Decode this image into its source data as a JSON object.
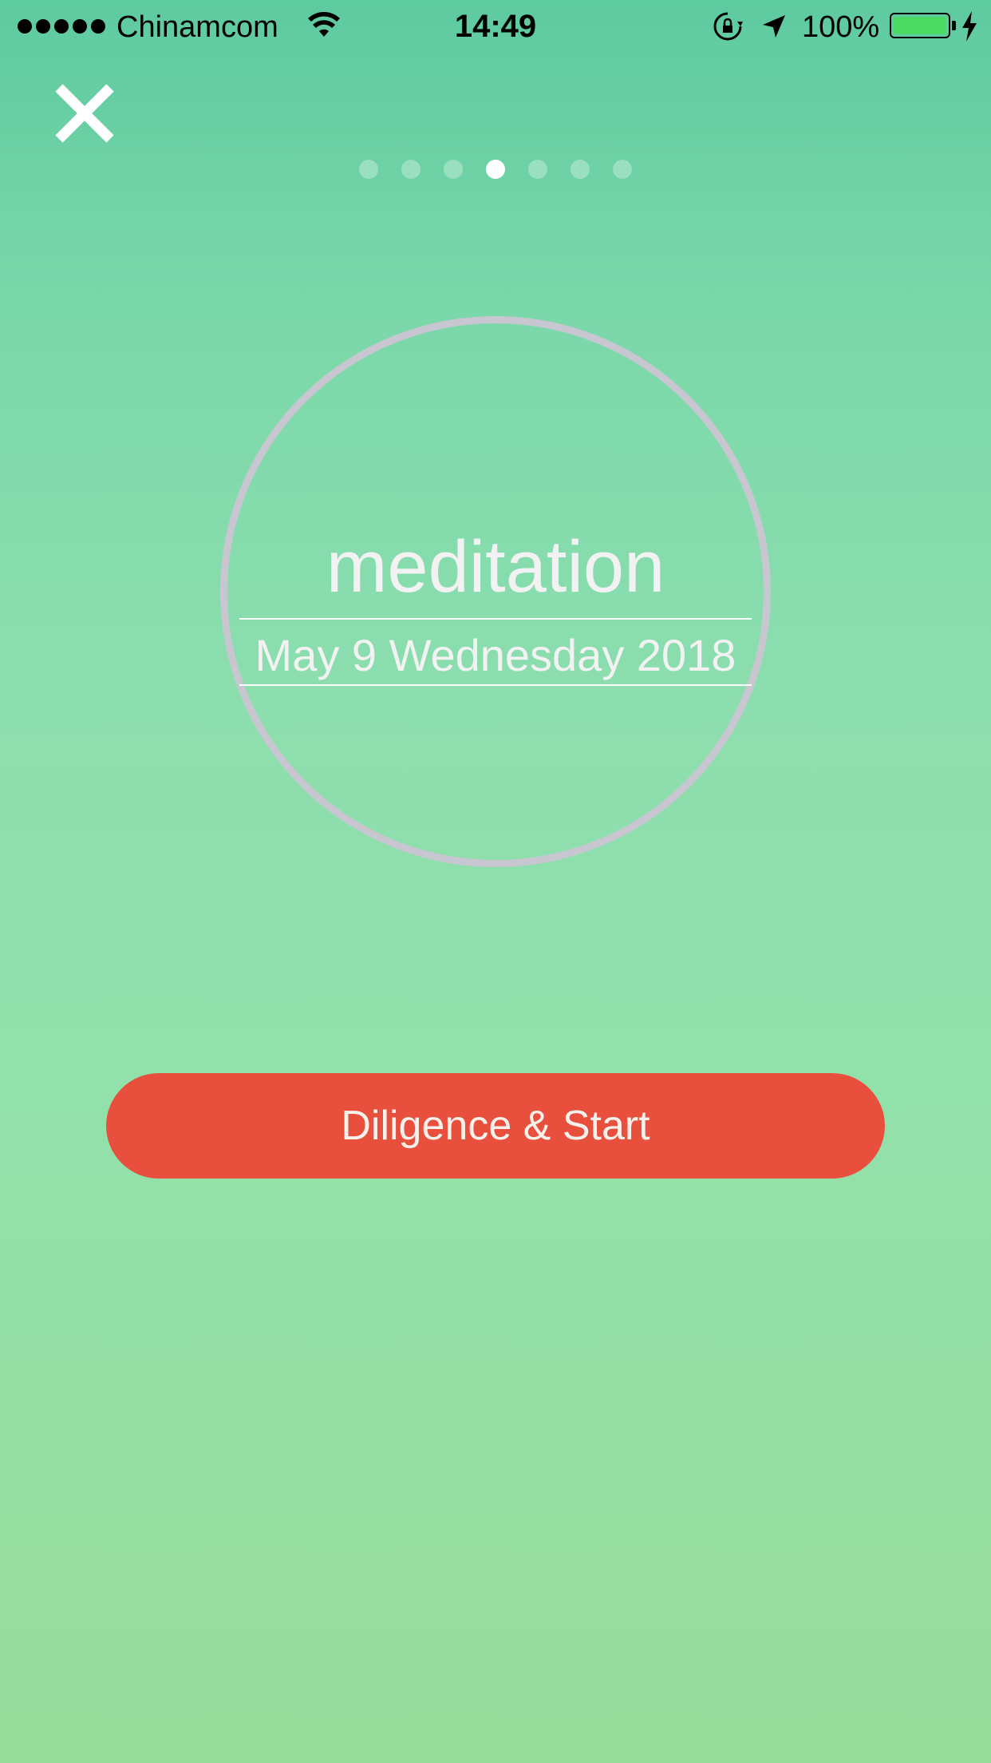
{
  "status_bar": {
    "carrier": "Chinamcom",
    "time": "14:49",
    "battery_percent": "100%",
    "battery_level": 1.0,
    "signal_bars": 5
  },
  "icons": {
    "close": "close-icon",
    "wifi": "wifi-icon",
    "rotation_lock": "rotation-lock-icon",
    "location": "location-arrow-icon",
    "battery": "battery-icon",
    "charging": "charging-bolt-icon"
  },
  "pager": {
    "count": 7,
    "active_index": 3
  },
  "activity": {
    "title": "meditation",
    "date": "May 9 Wednesday 2018"
  },
  "actions": {
    "start_label": "Diligence & Start"
  },
  "colors": {
    "background_top": "#5ecaa0",
    "background_bottom": "#97dc9a",
    "accent_button": "#e8503d",
    "circle_ring": "#c8c6d0",
    "battery_fill": "#4cd964"
  }
}
